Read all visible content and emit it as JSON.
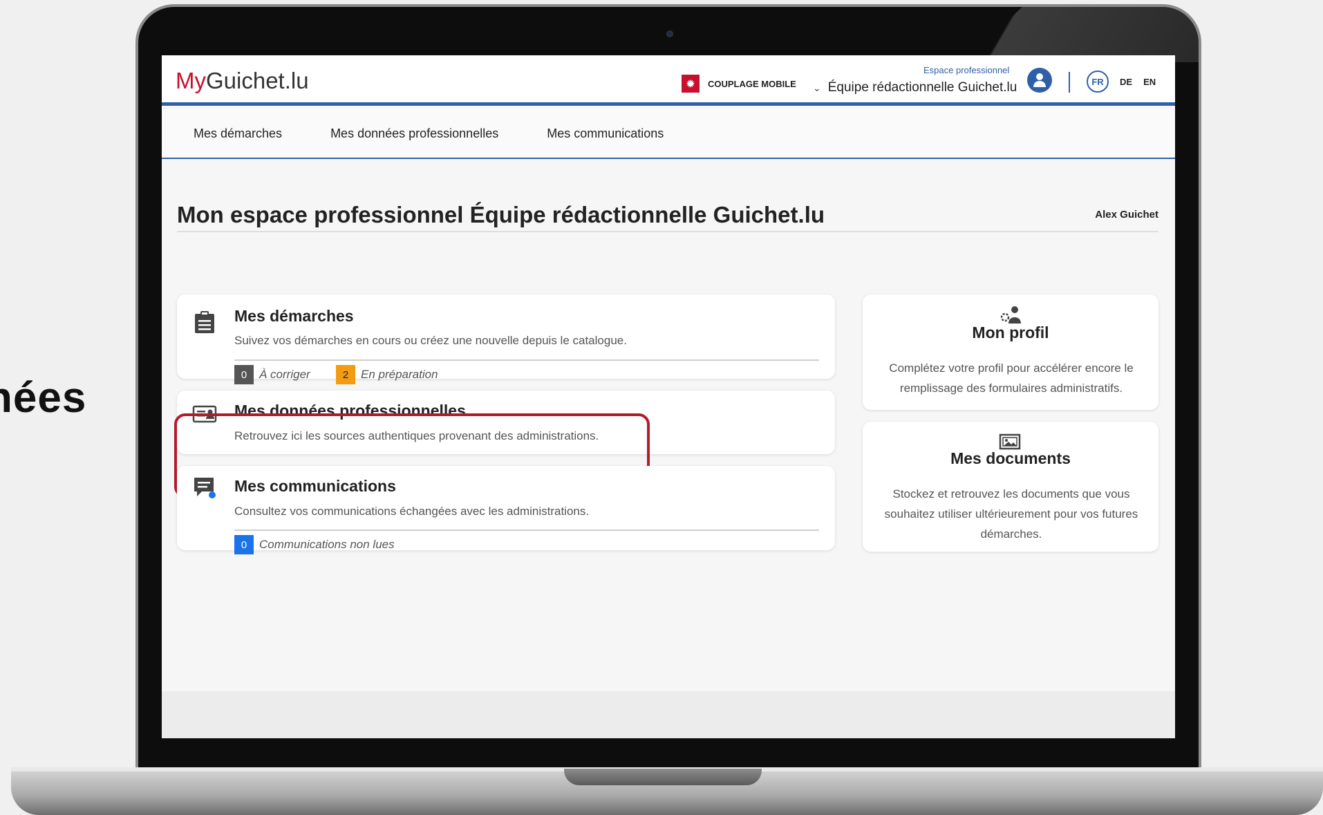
{
  "side_text": "nées",
  "header": {
    "logo_prefix": "My",
    "logo_suffix": "Guichet.lu",
    "couplage_label": "COUPLAGE MOBILE",
    "space_label": "Espace professionnel",
    "account_name": "Équipe rédactionnelle Guichet.lu",
    "languages": [
      "FR",
      "DE",
      "EN"
    ]
  },
  "nav": {
    "items": [
      "Mes démarches",
      "Mes données professionnelles",
      "Mes communications"
    ]
  },
  "page": {
    "title": "Mon espace professionnel Équipe rédactionnelle Guichet.lu",
    "user": "Alex Guichet"
  },
  "cards": {
    "demarches": {
      "title": "Mes démarches",
      "desc": "Suivez vos démarches en cours ou créez une nouvelle depuis le catalogue.",
      "status1_count": "0",
      "status1_label": "À corriger",
      "status2_count": "2",
      "status2_label": "En préparation"
    },
    "donnees": {
      "title": "Mes données professionnelles",
      "desc": "Retrouvez ici les sources authentiques provenant des administrations."
    },
    "communications": {
      "title": "Mes communications",
      "desc": "Consultez vos communications échangées avec les administrations.",
      "unread_count": "0",
      "unread_label": "Communications non lues"
    }
  },
  "side": {
    "profil": {
      "title": "Mon profil",
      "desc": "Complétez votre profil pour accélérer encore le remplissage des formulaires administratifs."
    },
    "documents": {
      "title": "Mes documents",
      "desc": "Stockez et retrouvez les documents que vous souhaitez utiliser ultérieurement pour vos futures démarches."
    }
  },
  "colors": {
    "brand_red": "#c8102e",
    "brand_blue": "#2f5fa6",
    "badge_grey": "#555555",
    "badge_orange": "#f39c12",
    "badge_blue": "#1a73e8",
    "highlight": "#b31b2a"
  }
}
